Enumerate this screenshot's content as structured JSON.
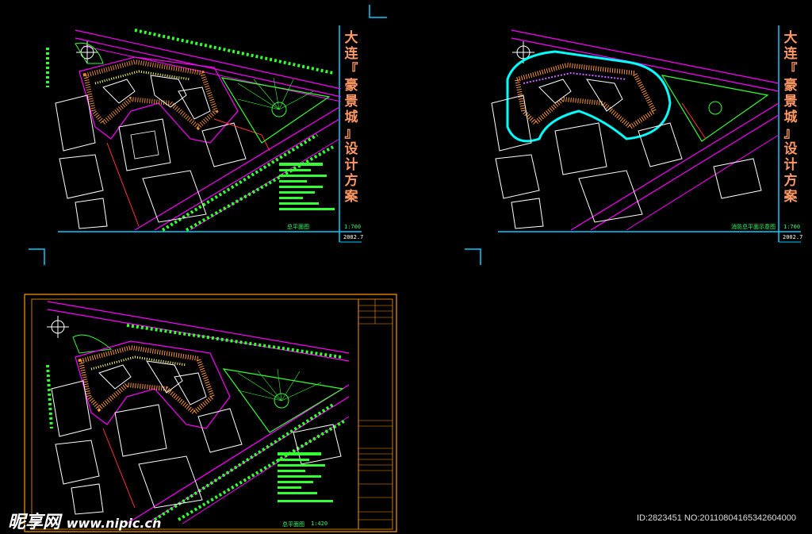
{
  "sheets": [
    {
      "title_chars": [
        "大",
        "连",
        "『",
        "豪",
        "景",
        "城",
        "』",
        "设",
        "计",
        "方",
        "案"
      ],
      "caption": "总平面图",
      "scale": "1:700",
      "date": "2002.7"
    },
    {
      "title_chars": [
        "大",
        "连",
        "『",
        "豪",
        "景",
        "城",
        "』",
        "设",
        "计",
        "方",
        "案"
      ],
      "caption": "消防总平面示意图",
      "scale": "1:700",
      "date": "2002.7"
    },
    {
      "caption": "总平面图",
      "scale": "1:420"
    }
  ],
  "watermark": {
    "brand": "昵享网",
    "url": "www.nipic.cn",
    "id_text": "ID:2823451 NO:20110804165342604000"
  },
  "colors": {
    "background": "#000000",
    "frame_cyan": "#00ccff",
    "road_magenta": "#ff00ff",
    "tree_green": "#33ff33",
    "building_white": "#ffffff",
    "title_orange": "#ff9966",
    "frame_orange": "#ff9900"
  }
}
